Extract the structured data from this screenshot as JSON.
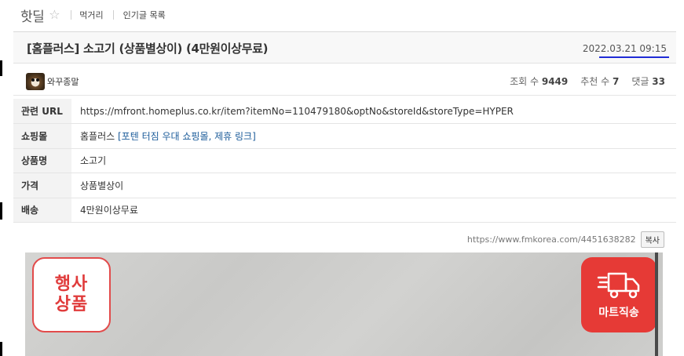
{
  "board": {
    "title": "핫딜",
    "breadcrumbs": [
      "먹거리",
      "인기글 목록"
    ]
  },
  "post": {
    "title": "[홈플러스] 소고기 (상품별상이) (4만원이상무료)",
    "date": "2022.03.21 09:15",
    "author": "와꾸종말",
    "views_label": "조회 수",
    "views": "9449",
    "recommend_label": "추천 수",
    "recommend": "7",
    "comments_label": "댓글",
    "comments": "33"
  },
  "details": {
    "url_label": "관련 URL",
    "url": "https://mfront.homeplus.co.kr/item?itemNo=110479180&optNo&storeId&storeType=HYPER",
    "mall_label": "쇼핑몰",
    "mall": "홈플러스",
    "mall_link": "[포텐 터짐 우대 쇼핑몰, 제휴 링크]",
    "product_label": "상품명",
    "product": "소고기",
    "price_label": "가격",
    "price": "상품별상이",
    "shipping_label": "배송",
    "shipping": "4만원이상무료"
  },
  "permalink": {
    "url": "https://www.fmkorea.com/4451638282",
    "copy_label": "복사"
  },
  "image": {
    "event_badge_line1": "행사",
    "event_badge_line2": "상품",
    "mart_badge": "마트직송"
  },
  "colors": {
    "accent_underline": "#1f2bd6",
    "link": "#1c5c9a",
    "badge_red": "#e63a36"
  }
}
